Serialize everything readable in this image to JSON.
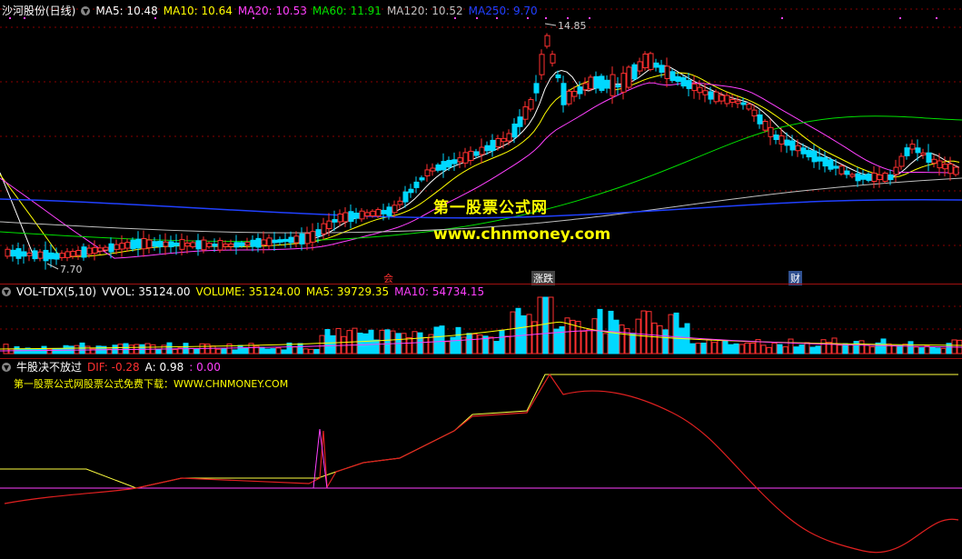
{
  "main": {
    "title": "沙河股份(日线)",
    "ma": [
      {
        "label": "MA5: 10.48",
        "color": "#ffffff"
      },
      {
        "label": "MA10: 10.64",
        "color": "#ffff00"
      },
      {
        "label": "MA20: 10.53",
        "color": "#ff40ff"
      },
      {
        "label": "MA60: 11.91",
        "color": "#00e000"
      },
      {
        "label": "MA120: 10.52",
        "color": "#c0c0c0"
      },
      {
        "label": "MA250: 9.70",
        "color": "#2040ff"
      }
    ],
    "high_label": "14.85",
    "low_label": "7.70",
    "watermark_title": "第一股票公式网",
    "watermark_url": "www.chnmoney.com",
    "markers": [
      "会",
      "涨跌",
      "财"
    ]
  },
  "volume": {
    "name": "VOL-TDX(5,10)",
    "vvol": "VVOL: 35124.00",
    "volume": "VOLUME: 35124.00",
    "ma5": "MA5: 39729.35",
    "ma10": "MA10: 54734.15"
  },
  "indicator": {
    "name": "牛股决不放过",
    "dif": "DIF: -0.28",
    "a": "A: 0.98",
    "zero": ": 0.00",
    "promo": "第一股票公式网股票公式免费下载：WWW.CHNMONEY.COM"
  },
  "colors": {
    "up": "#ff3030",
    "down": "#00d8ff",
    "grid": "#8a0000"
  }
}
